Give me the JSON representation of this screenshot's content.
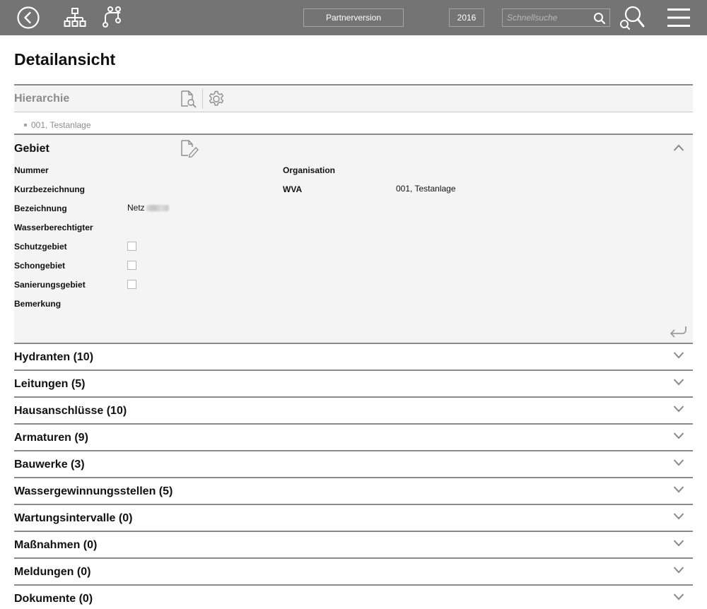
{
  "topbar": {
    "partner_label": "Partnerversion",
    "year": "2016",
    "search_placeholder": "Schnellsuche",
    "background": "#747474"
  },
  "page": {
    "title": "Detailansicht"
  },
  "hierarchy": {
    "title": "Hierarchie",
    "items": [
      "001, Testanlage"
    ]
  },
  "gebiet": {
    "title": "Gebiet",
    "fields": {
      "nummer": "Nummer",
      "kurzbezeichnung": "Kurzbezeichnung",
      "bezeichnung": "Bezeichnung",
      "bezeichnung_value": "Netz",
      "wasserberechtigter": "Wasserberechtigter",
      "schutzgebiet": "Schutzgebiet",
      "schongebiet": "Schongebiet",
      "sanierungsgebiet": "Sanierungsgebiet",
      "bemerkung": "Bemerkung",
      "organisation": "Organisation",
      "wva": "WVA",
      "wva_value": "001, Testanlage"
    },
    "checkboxes": {
      "schutzgebiet": false,
      "schongebiet": false,
      "sanierungsgebiet": false
    }
  },
  "sections": [
    {
      "label": "Hydranten (10)"
    },
    {
      "label": "Leitungen (5)"
    },
    {
      "label": "Hausanschlüsse (10)"
    },
    {
      "label": "Armaturen (9)"
    },
    {
      "label": "Bauwerke (3)"
    },
    {
      "label": "Wassergewinnungsstellen (5)"
    },
    {
      "label": "Wartungsintervalle (0)"
    },
    {
      "label": "Maßnahmen (0)"
    },
    {
      "label": "Meldungen (0)"
    },
    {
      "label": "Dokumente (0)"
    }
  ]
}
